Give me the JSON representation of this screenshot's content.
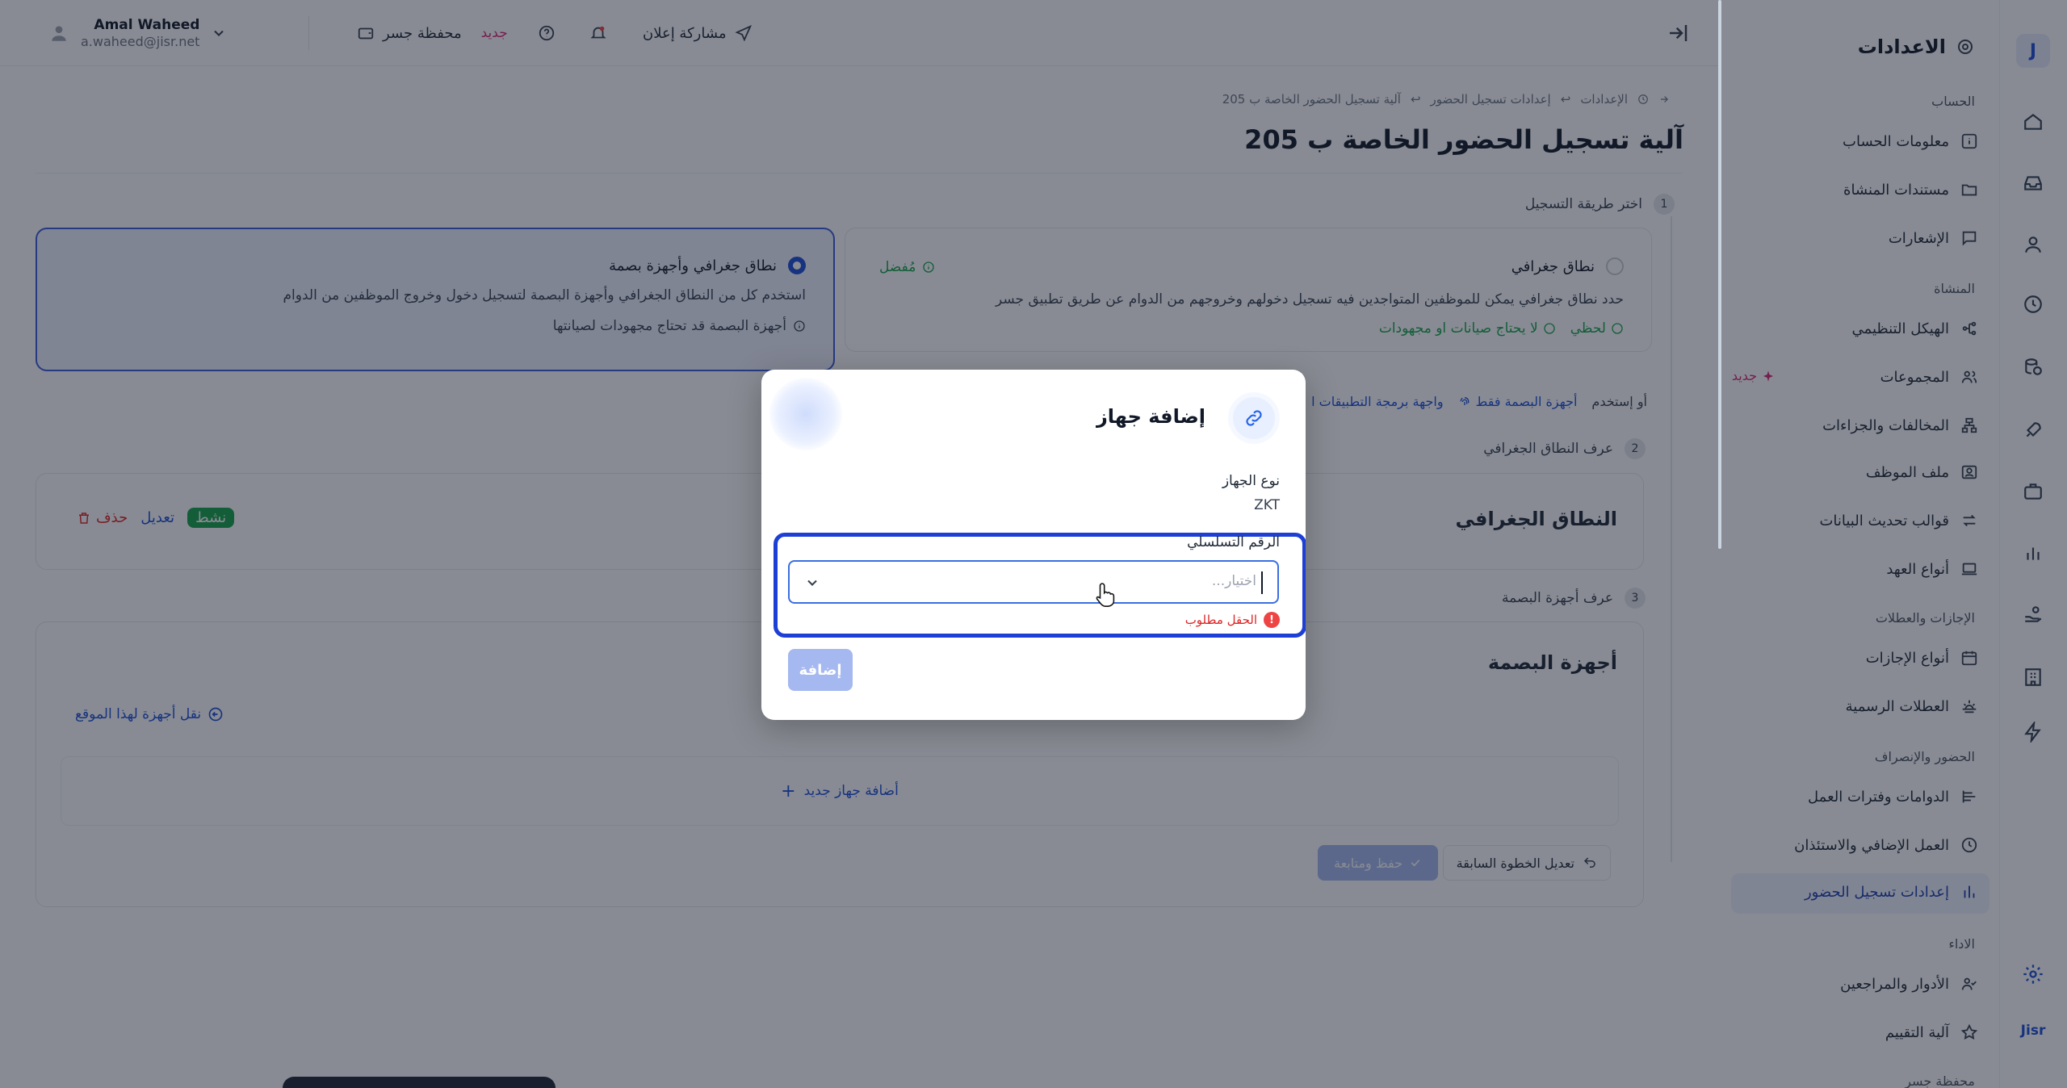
{
  "rail": {
    "logo": "J",
    "brand": "Jisr"
  },
  "sidebar": {
    "title": "الاعدادات",
    "sections": {
      "account": "الحساب",
      "org": "المنشاة",
      "leaves": "الإجازات والعطلات",
      "attendance": "الحضور والإنصراف",
      "performance": "الاداء",
      "wallet": "محفظة جسر"
    },
    "items": [
      {
        "label": "معلومات الحساب"
      },
      {
        "label": "مستندات المنشاة"
      },
      {
        "label": "الإشعارات"
      },
      {
        "label": "الهيكل التنظيمي"
      },
      {
        "label": "المجموعات"
      },
      {
        "label": "المخالفات والجزاءات"
      },
      {
        "label": "ملف الموظف"
      },
      {
        "label": "قوالب تحديث البيانات"
      },
      {
        "label": "أنواع العهد"
      },
      {
        "label": "أنواع الإجازات"
      },
      {
        "label": "العطلات الرسمية"
      },
      {
        "label": "الدوامات وفترات العمل"
      },
      {
        "label": "العمل الإضافي والاستئذان"
      },
      {
        "label": "إعدادات تسجيل الحضور"
      },
      {
        "label": "الأدوار والمراجعين"
      },
      {
        "label": "آلية التقييم"
      }
    ],
    "new_badge": "جديد"
  },
  "topbar": {
    "user_name": "Amal Waheed",
    "user_email": "a.waheed@jisr.net",
    "wallet_label": "محفظة جسر",
    "wallet_badge": "جديد",
    "share_label": "مشاركة إعلان"
  },
  "breadcrumb": [
    "الإعدادات",
    "إعدادات تسجيل الحضور",
    "آلية تسجيل الحضور الخاصة ب 205"
  ],
  "page_title": "آلية تسجيل الحضور الخاصة ب 205",
  "steps": {
    "step1": {
      "num": "1",
      "label": "اختر طريقة التسجيل"
    },
    "step2": {
      "num": "2",
      "label": "عرف النطاق الجغرافي"
    },
    "step3": {
      "num": "3",
      "label": "عرف أجهزة البصمة"
    }
  },
  "method_geo": {
    "title": "نطاق جغرافي",
    "desc": "حدد نطاق جغرافي يمكن للموظفين المتواجدين فيه تسجيل دخولهم وخروجهم من الدوام عن طريق تطبيق جسر",
    "tag_preferred": "مُفضل",
    "tag_instant": "لحظي",
    "tag_nomaint": "لا يحتاج صيانات او مجهودات"
  },
  "method_geo_bio": {
    "title": "نطاق جغرافي وأجهزة بصمة",
    "desc": "استخدم كل من النطاق الجغرافي وأجهزة البصمة لتسجيل دخول وخروج الموظفين من الدوام",
    "warning": "أجهزة البصمة قد تحتاج مجهودات لصيانتها"
  },
  "alt_options": {
    "prefix": "أو إستخدم",
    "bio_only": "أجهزة البصمة فقط",
    "api": "واجهة برمجة التطبيقات ا"
  },
  "geo_card": {
    "title": "النطاق الجغرافي",
    "status": "نشط",
    "edit": "تعديل",
    "delete": "حذف"
  },
  "bio_card": {
    "title": "أجهزة البصمة",
    "transfer": "نقل أجهزة لهذا الموقع",
    "add_device": "أضافة جهاز جديد",
    "prev_step": "تعديل الخطوة السابقة",
    "save_continue": "حفظ ومتابعة"
  },
  "modal": {
    "title": "إضافة جهاز",
    "device_type_label": "نوع الجهاز",
    "device_type_value": "ZKT",
    "serial_label": "الرقم التسلسلي",
    "serial_placeholder": "اختيار...",
    "error": "الحقل مطلوب",
    "submit": "إضافة"
  },
  "colors": {
    "primary": "#1d4ed8",
    "success": "#16a34a",
    "danger": "#dc2626",
    "badge_new": "#db2777"
  }
}
